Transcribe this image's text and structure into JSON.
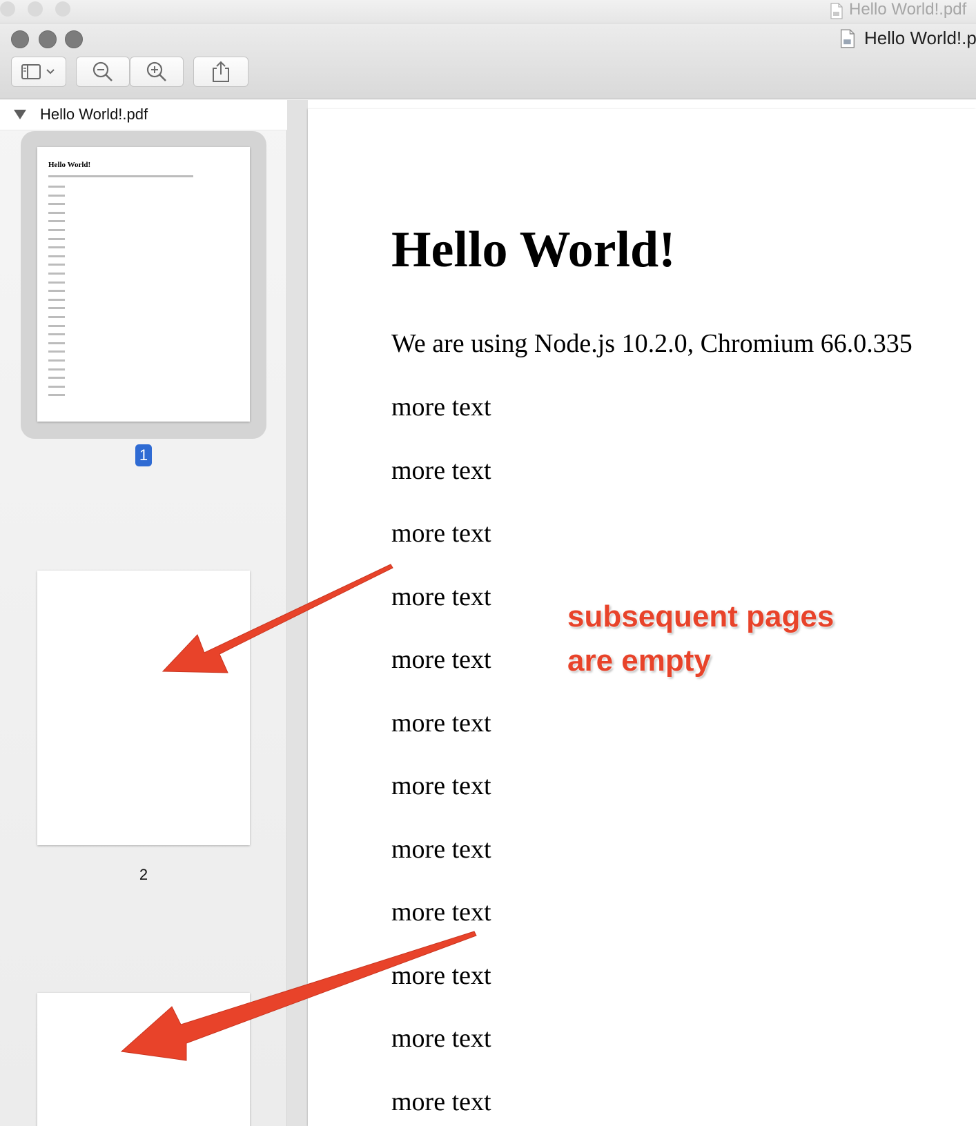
{
  "background_window": {
    "title": "Hello World!.pdf"
  },
  "window": {
    "title": "Hello World!.pdf"
  },
  "toolbar": {
    "sidebar_toggle": "sidebar-view-icon",
    "zoom_out": "zoom-out-icon",
    "zoom_in": "zoom-in-icon",
    "share": "share-icon"
  },
  "sidebar": {
    "document_name": "Hello World!.pdf",
    "thumbnail_1": {
      "title": "Hello World!",
      "page_number": "1"
    },
    "thumbnail_2": {
      "page_number": "2"
    }
  },
  "document": {
    "title": "Hello World!",
    "intro": "We are using Node.js 10.2.0, Chromium 66.0.335",
    "lines": [
      "more text",
      "more text",
      "more text",
      "more text",
      "more text",
      "more text",
      "more text",
      "more text",
      "more text",
      "more text",
      "more text",
      "more text"
    ]
  },
  "annotation": {
    "line1": "subsequent pages",
    "line2": "are empty",
    "color": "#e8432a"
  },
  "colors": {
    "selection_badge": "#2f6bd3",
    "annotation": "#e8432a"
  }
}
